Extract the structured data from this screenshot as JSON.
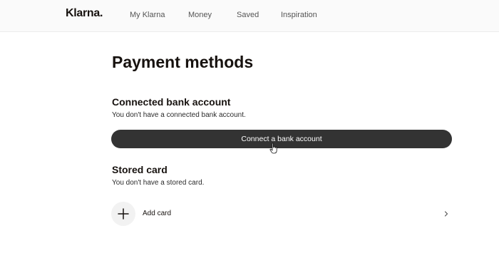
{
  "header": {
    "logo": "Klarna.",
    "nav": [
      "My Klarna",
      "Money",
      "Saved",
      "Inspiration"
    ]
  },
  "page": {
    "title": "Payment methods"
  },
  "bank": {
    "title": "Connected bank account",
    "description": "You don't have a connected bank account.",
    "button_label": "Connect a bank account"
  },
  "card": {
    "title": "Stored card",
    "description": "You don't have a stored card.",
    "add_label": "Add card"
  },
  "colors": {
    "button_bg": "#333333",
    "text": "#17120f"
  }
}
